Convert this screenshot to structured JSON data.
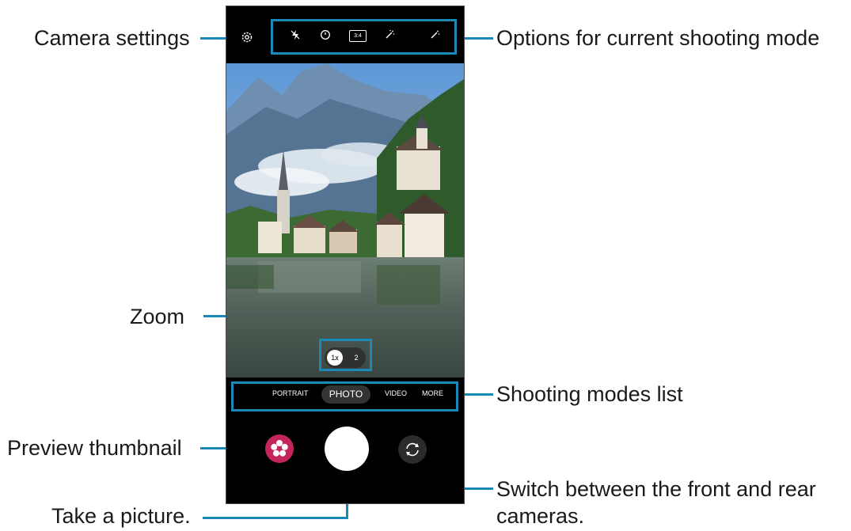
{
  "annotations": {
    "camera_settings": "Camera settings",
    "options_mode": "Options for current shooting mode",
    "zoom": "Zoom",
    "shooting_modes": "Shooting modes list",
    "preview_thumbnail": "Preview thumbnail",
    "take_picture": "Take a picture.",
    "switch_cameras_line1": "Switch between the front and rear",
    "switch_cameras_line2": "cameras."
  },
  "camera": {
    "top_icons": [
      "gear-icon",
      "flash-off-icon",
      "timer-icon",
      "aspect-ratio-icon",
      "filter-icon"
    ],
    "aspect_ratio": "3:4",
    "zoom": {
      "active": "1x",
      "other": "2"
    },
    "modes": {
      "portrait": "PORTRAIT",
      "photo": "PHOTO",
      "video": "VIDEO",
      "more": "MORE"
    },
    "active_mode": "PHOTO"
  },
  "colors": {
    "accent": "#1a89b8",
    "thumbnail": "#c4255a"
  }
}
